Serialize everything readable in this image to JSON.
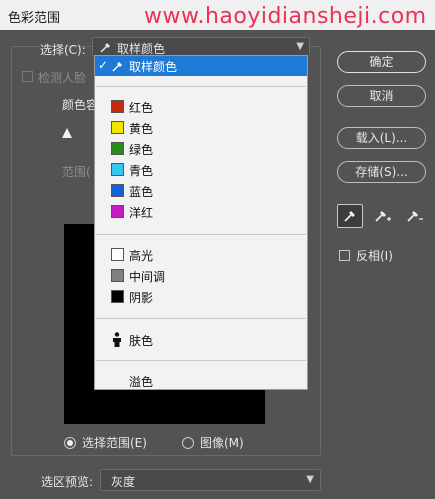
{
  "window": {
    "title": "色彩范围"
  },
  "watermark": "www.haoyidiansheji.com",
  "select": {
    "label": "选择(C):",
    "value": "取样颜色"
  },
  "faint": {
    "detect_faces": "检测人脸",
    "fuzziness": "颜色容",
    "range": "范围("
  },
  "menu": {
    "sampled": "取样颜色",
    "colors": [
      {
        "label": "红色",
        "color": "#c42a10"
      },
      {
        "label": "黄色",
        "color": "#f2e600"
      },
      {
        "label": "绿色",
        "color": "#2c8a18"
      },
      {
        "label": "青色",
        "color": "#36c4f0"
      },
      {
        "label": "蓝色",
        "color": "#1460d8"
      },
      {
        "label": "洋红",
        "color": "#c41cc4"
      }
    ],
    "tones": [
      {
        "label": "高光",
        "color": "#ffffff"
      },
      {
        "label": "中间调",
        "color": "#808080"
      },
      {
        "label": "阴影",
        "color": "#000000"
      }
    ],
    "skin": "肤色",
    "overflow": "溢色"
  },
  "buttons": {
    "ok": "确定",
    "cancel": "取消",
    "load": "载入(L)...",
    "save": "存储(S)..."
  },
  "invert": {
    "label": "反相(I)"
  },
  "radios": {
    "selection": "选择范围(E)",
    "image": "图像(M)"
  },
  "preview": {
    "label": "选区预览:",
    "value": "灰度"
  }
}
